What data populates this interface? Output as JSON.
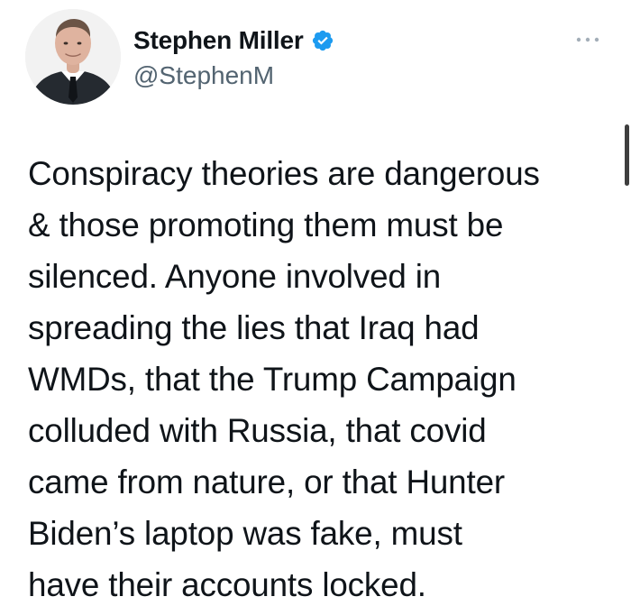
{
  "author": {
    "display_name": "Stephen Miller",
    "handle": "@StephenM",
    "verified": true
  },
  "tweet": {
    "lines": [
      "Conspiracy theories are dangerous",
      "& those promoting them must be",
      "silenced. Anyone involved in",
      "spreading the lies that Iraq had",
      "WMDs, that the Trump Campaign",
      "colluded with Russia, that covid",
      "came from nature, or that Hunter",
      "Biden’s laptop was fake, must",
      "have their accounts locked."
    ]
  },
  "icons": {
    "verified": "verified-badge-icon",
    "more": "more-options-icon"
  },
  "colors": {
    "text_primary": "#0f1419",
    "text_secondary": "#536471",
    "verified_blue": "#1d9bf0",
    "background": "#ffffff",
    "scrollbar": "#3e3e3e"
  }
}
